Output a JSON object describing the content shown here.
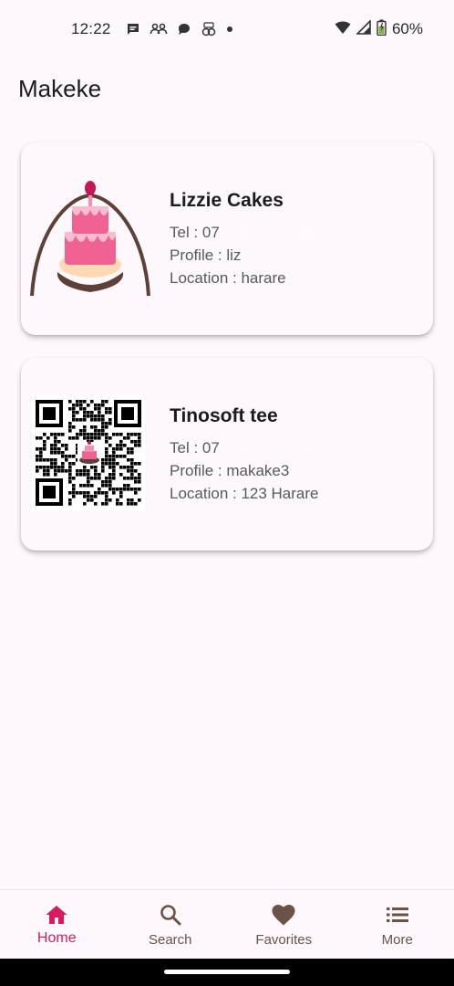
{
  "status_bar": {
    "time": "12:22",
    "battery": "60%",
    "icons": [
      "message-icon",
      "people-icon",
      "chat-bubble-icon",
      "cake-notification-icon",
      "dot-icon",
      "wifi-icon",
      "signal-icon",
      "battery-icon"
    ]
  },
  "app": {
    "title": "Makeke"
  },
  "shops": [
    {
      "name": "Lizzie Cakes",
      "tel": "Tel : 07",
      "profile": "Profile : liz",
      "location": "Location : harare",
      "image": "cake-logo"
    },
    {
      "name": "Tinosoft tee",
      "tel": "Tel : 07",
      "profile": "Profile : makake3",
      "location": "Location : 123 Harare",
      "image": "qr-code"
    }
  ],
  "bottom_nav": {
    "items": [
      {
        "label": "Home",
        "icon": "home-icon",
        "active": true
      },
      {
        "label": "Search",
        "icon": "search-icon",
        "active": false
      },
      {
        "label": "Favorites",
        "icon": "heart-icon",
        "active": false
      },
      {
        "label": "More",
        "icon": "list-icon",
        "active": false
      }
    ]
  },
  "colors": {
    "accent": "#d81b60",
    "nav_icon": "#6b5248",
    "background": "#fdf8fb",
    "cake_pink": "#f06292",
    "cake_brown": "#5d4037"
  }
}
